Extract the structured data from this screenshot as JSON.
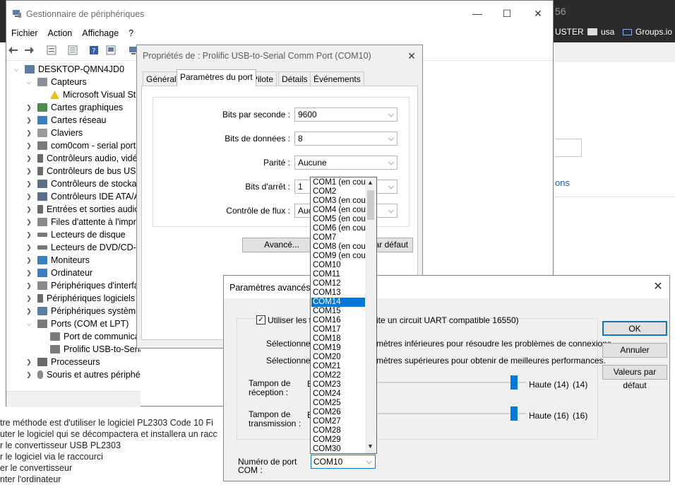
{
  "browser": {
    "tab_number": "56",
    "bookmarks": [
      "USTER",
      "usa",
      "Groups.io"
    ],
    "side_link": "ons",
    "article_lines": [
      "tre méthode est d'utiliser le logiciel PL2303 Code 10 Fi",
      "uter le logiciel qui se décompactera et installera un racc",
      "r le convertisseur USB PL2303",
      "r le logiciel via le raccourci",
      "er le convertisseur",
      "nter l'ordinateur"
    ]
  },
  "device_manager": {
    "title": "Gestionnaire de périphériques",
    "menu": [
      "Fichier",
      "Action",
      "Affichage",
      "?"
    ],
    "tree": [
      {
        "label": "DESKTOP-QMN4JD0",
        "level": 0,
        "expanded": true,
        "icon": "computer-icon"
      },
      {
        "label": "Capteurs",
        "level": 1,
        "expanded": true,
        "icon": "sensor-icon"
      },
      {
        "label": "Microsoft Visual Stu",
        "level": 2,
        "icon": "warning-icon"
      },
      {
        "label": "Cartes graphiques",
        "level": 1,
        "icon": "display-adapter-icon"
      },
      {
        "label": "Cartes réseau",
        "level": 1,
        "icon": "network-icon"
      },
      {
        "label": "Claviers",
        "level": 1,
        "icon": "keyboard-icon"
      },
      {
        "label": "com0com - serial port e",
        "level": 1,
        "icon": "port-icon"
      },
      {
        "label": "Contrôleurs audio, vidé",
        "level": 1,
        "icon": "audio-icon"
      },
      {
        "label": "Contrôleurs de bus USB",
        "level": 1,
        "icon": "usb-icon"
      },
      {
        "label": "Contrôleurs de stockag",
        "level": 1,
        "icon": "storage-icon"
      },
      {
        "label": "Contrôleurs IDE ATA/AT",
        "level": 1,
        "icon": "ide-icon"
      },
      {
        "label": "Entrées et sorties audio",
        "level": 1,
        "icon": "speaker-icon"
      },
      {
        "label": "Files d'attente à l'impre",
        "level": 1,
        "icon": "printer-icon"
      },
      {
        "label": "Lecteurs de disque",
        "level": 1,
        "icon": "disk-icon"
      },
      {
        "label": "Lecteurs de DVD/CD-RO",
        "level": 1,
        "icon": "dvd-icon"
      },
      {
        "label": "Moniteurs",
        "level": 1,
        "icon": "monitor-icon"
      },
      {
        "label": "Ordinateur",
        "level": 1,
        "icon": "computer-icon"
      },
      {
        "label": "Périphériques d'interfac",
        "level": 1,
        "icon": "hid-icon"
      },
      {
        "label": "Périphériques logiciels",
        "level": 1,
        "icon": "software-device-icon"
      },
      {
        "label": "Périphériques système",
        "level": 1,
        "icon": "system-icon"
      },
      {
        "label": "Ports (COM et LPT)",
        "level": 1,
        "expanded": true,
        "icon": "port-icon"
      },
      {
        "label": "Port de communica",
        "level": 2,
        "icon": "port-icon"
      },
      {
        "label": "Prolific USB-to-Seria",
        "level": 2,
        "icon": "port-icon"
      },
      {
        "label": "Processeurs",
        "level": 1,
        "icon": "cpu-icon"
      },
      {
        "label": "Souris et autres périphériques de pointage",
        "level": 1,
        "icon": "mouse-icon"
      }
    ]
  },
  "properties": {
    "title": "Propriétés de : Prolific USB-to-Serial Comm Port (COM10)",
    "tabs": [
      "Général",
      "Paramètres du port",
      "Pilote",
      "Détails",
      "Événements"
    ],
    "active_tab": 1,
    "fields": [
      {
        "label": "Bits par seconde :",
        "value": "9600"
      },
      {
        "label": "Bits de données :",
        "value": "8"
      },
      {
        "label": "Parité :",
        "value": "Aucune"
      },
      {
        "label": "Bits d'arrêt :",
        "value": "1"
      },
      {
        "label": "Contrôle de flux :",
        "value": "Aucu"
      }
    ],
    "advanced_button": "Avancé...",
    "defaults_button": "ar défaut"
  },
  "advanced": {
    "title": "Paramètres avancés p",
    "checkbox_label_a": "Utiliser les tam",
    "checkbox_label_b": "ite un circuit UART compatible 16550)",
    "checked": true,
    "hint_low_a": "Sélectionnez",
    "hint_low_b": "mètres inférieures pour résoudre les problèmes de connexions.",
    "hint_high_a": "Sélectionnez",
    "hint_high_b": "mètres supérieures pour obtenir de meilleures performances.",
    "rx_label": "Tampon de\nréception :",
    "tx_label": "Tampon de\ntransmission :",
    "rx_prefix": "B",
    "tx_prefix": "B",
    "rx_level": "Haute (14)",
    "rx_value": "(14)",
    "tx_level": "Haute (16)",
    "tx_value": "(16)",
    "port_label": "Numéro de port\nCOM :",
    "port_value": "COM10",
    "ok": "OK",
    "cancel": "Annuler",
    "defaults": "Valeurs par défaut"
  },
  "dropdown": {
    "items": [
      "COM1 (en cour",
      "COM2",
      "COM3 (en cour",
      "COM4 (en cour",
      "COM5 (en cour",
      "COM6 (en cour",
      "COM7",
      "COM8 (en cour",
      "COM9 (en cour",
      "COM10",
      "COM11",
      "COM12",
      "COM13",
      "COM14",
      "COM15",
      "COM16",
      "COM17",
      "COM18",
      "COM19",
      "COM20",
      "COM21",
      "COM22",
      "COM23",
      "COM24",
      "COM25",
      "COM26",
      "COM27",
      "COM28",
      "COM29",
      "COM30"
    ],
    "selected_index": 13
  },
  "colors": {
    "accent": "#0078d7",
    "dialog_bg": "#f0f0f0",
    "dark_bar": "#2b2b2b"
  }
}
